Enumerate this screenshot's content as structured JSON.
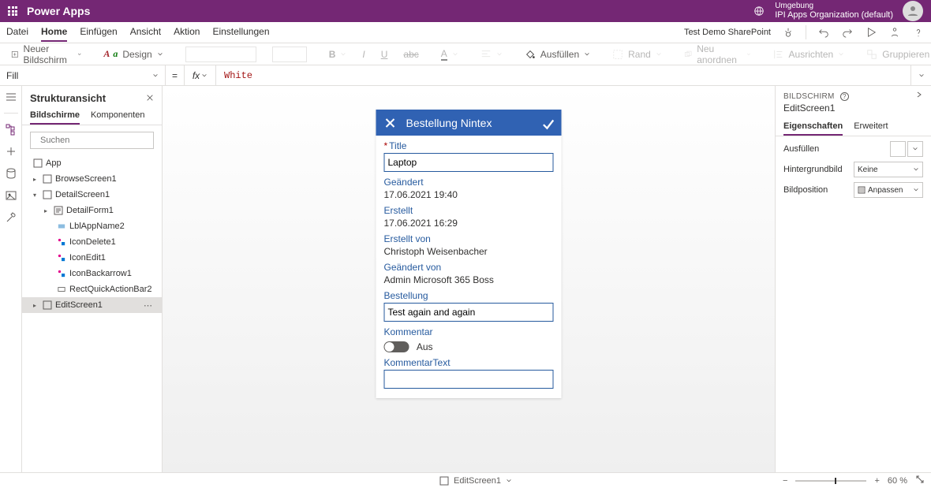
{
  "header": {
    "app_name": "Power Apps",
    "env_label": "Umgebung",
    "env_name": "IPI Apps Organization (default)"
  },
  "menus": {
    "datei": "Datei",
    "home": "Home",
    "einfuegen": "Einfügen",
    "ansicht": "Ansicht",
    "aktion": "Aktion",
    "einstellungen": "Einstellungen",
    "datasource": "Test Demo SharePoint"
  },
  "ribbon": {
    "neuer_bildschirm": "Neuer Bildschirm",
    "design": "Design",
    "ausfuellen": "Ausfüllen",
    "rand": "Rand",
    "neu_anordnen": "Neu anordnen",
    "ausrichten": "Ausrichten",
    "gruppieren": "Gruppieren"
  },
  "formula": {
    "prop": "Fill",
    "value": "White"
  },
  "tree": {
    "title": "Strukturansicht",
    "tab_screens": "Bildschirme",
    "tab_components": "Komponenten",
    "search_placeholder": "Suchen",
    "app": "App",
    "browse": "BrowseScreen1",
    "detail": "DetailScreen1",
    "detailform": "DetailForm1",
    "lbl": "LblAppName2",
    "icon_delete": "IconDelete1",
    "icon_edit": "IconEdit1",
    "icon_back": "IconBackarrow1",
    "rect": "RectQuickActionBar2",
    "edit": "EditScreen1"
  },
  "form": {
    "title": "Bestellung Nintex",
    "title_lbl": "Title",
    "title_val": "Laptop",
    "modified_lbl": "Geändert",
    "modified_val": "17.06.2021 19:40",
    "created_lbl": "Erstellt",
    "created_val": "17.06.2021 16:29",
    "createdby_lbl": "Erstellt von",
    "createdby_val": "Christoph Weisenbacher",
    "modifiedby_lbl": "Geändert von",
    "modifiedby_val": "Admin Microsoft 365 Boss",
    "bestellung_lbl": "Bestellung",
    "bestellung_val": "Test again and again",
    "kommentar_lbl": "Kommentar",
    "kommentar_off": "Aus",
    "kommentartext_lbl": "KommentarText",
    "kommentartext_val": ""
  },
  "props": {
    "section": "BILDSCHIRM",
    "screen": "EditScreen1",
    "tab_props": "Eigenschaften",
    "tab_adv": "Erweitert",
    "fill_lbl": "Ausfüllen",
    "bg_lbl": "Hintergrundbild",
    "bg_val": "Keine",
    "pos_lbl": "Bildposition",
    "pos_val": "Anpassen"
  },
  "status": {
    "breadcrumb": "EditScreen1",
    "zoom": "60 %"
  }
}
